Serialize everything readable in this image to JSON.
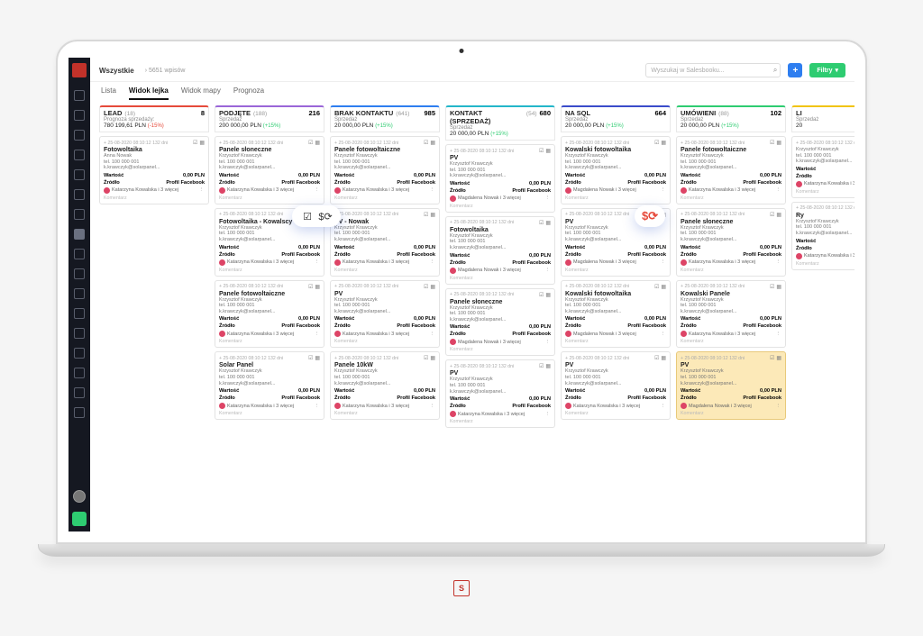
{
  "breadcrumb": {
    "root": "Wszystkie",
    "sub": "› 5651 wpisów"
  },
  "search": {
    "placeholder": "Wyszukaj w Salesbooku..."
  },
  "buttons": {
    "add": "+",
    "filter": "Filtry"
  },
  "tabs": [
    "Lista",
    "Widok lejka",
    "Widok mapy",
    "Prognoza"
  ],
  "active_tab": 1,
  "columns": [
    {
      "title": "LEAD",
      "cnt": "(18)",
      "num": "8",
      "sub1": "Prognoza sprzedaży:",
      "sub2": "780 199,61 PLN",
      "pct": "(-15%)",
      "neg": true,
      "color": "#e64a3b"
    },
    {
      "title": "PODJĘTE",
      "cnt": "(188)",
      "num": "216",
      "sub1": "Sprzedaż",
      "sub2": "200 000,00 PLN",
      "pct": "(+15%)",
      "color": "#9a66d8"
    },
    {
      "title": "BRAK KONTAKTU",
      "cnt": "(641)",
      "num": "985",
      "sub1": "Sprzedaż",
      "sub2": "20 000,00 PLN",
      "pct": "(+15%)",
      "color": "#2e7ef0"
    },
    {
      "title": "KONTAKT (SPRZEDAŻ)",
      "cnt": "(54)",
      "num": "680",
      "sub1": "Sprzedaż",
      "sub2": "20 000,00 PLN",
      "pct": "(+15%)",
      "color": "#24b6c9"
    },
    {
      "title": "NA SQL",
      "cnt": "",
      "num": "664",
      "sub1": "Sprzedaż",
      "sub2": "20 000,00 PLN",
      "pct": "(+15%)",
      "color": "#3b4cca"
    },
    {
      "title": "UMÓWIENI",
      "cnt": "(88)",
      "num": "102",
      "sub1": "Sprzedaż",
      "sub2": "20 000,00 PLN",
      "pct": "(+15%)",
      "color": "#2ecc71"
    },
    {
      "title": "LI",
      "cnt": "",
      "num": "",
      "sub1": "Sprzedaż",
      "sub2": "20",
      "pct": "",
      "color": "#f1c40f"
    }
  ],
  "card_common": {
    "meta": "+ 25-08-2020  08:10:12  132 dni",
    "person": "Krzysztof Krawczyk",
    "phone": "tel. 100 000 001",
    "email": "k.krawczyk@solarpanel...",
    "val_l": "Wartość",
    "val_r": "0,00 PLN",
    "src_l": "Źródło",
    "src_r": "Profil Facebook",
    "assignK": "Katarzyna Kowalska i 3 więcej",
    "assignM": "Magdalena Nowak i 3 więcej",
    "comment": "Komentarz"
  },
  "col_cards": [
    [
      {
        "t": "Fotowoltaika",
        "p": "Anna Nowak",
        "a": "K"
      }
    ],
    [
      {
        "t": "Panele słoneczne",
        "a": "K"
      },
      {
        "t": "Fotowoltaika - Kowalscy",
        "a": "K"
      },
      {
        "t": "Panele fotowoltaiczne",
        "a": "K"
      },
      {
        "t": "Solar Panel",
        "a": "K"
      }
    ],
    [
      {
        "t": "Panele fotowoltaiczne",
        "a": "K"
      },
      {
        "t": "PV - Nowak",
        "a": "K"
      },
      {
        "t": "PV",
        "a": "K"
      },
      {
        "t": "Panele 10kW",
        "a": "K"
      }
    ],
    [
      {
        "t": "PV",
        "a": "M"
      },
      {
        "t": "Fotowoltaika",
        "a": "M"
      },
      {
        "t": "Panele słoneczne",
        "a": "M"
      },
      {
        "t": "PV",
        "a": "K"
      }
    ],
    [
      {
        "t": "Kowalski fotowoltaika",
        "a": "M"
      },
      {
        "t": "PV",
        "a": "M"
      },
      {
        "t": "Kowalski fotowoltaika",
        "a": "M"
      },
      {
        "t": "PV",
        "a": "K"
      }
    ],
    [
      {
        "t": "Panele fotowoltaiczne",
        "a": "K"
      },
      {
        "t": "Panele słoneczne",
        "a": "K"
      },
      {
        "t": "Kowalski Panele",
        "a": "K"
      },
      {
        "t": "PV",
        "a": "M",
        "hl": true
      }
    ],
    [
      {
        "t": "",
        "a": "K"
      },
      {
        "t": "Ry",
        "a": "K"
      }
    ]
  ],
  "footer_glyph": "S"
}
